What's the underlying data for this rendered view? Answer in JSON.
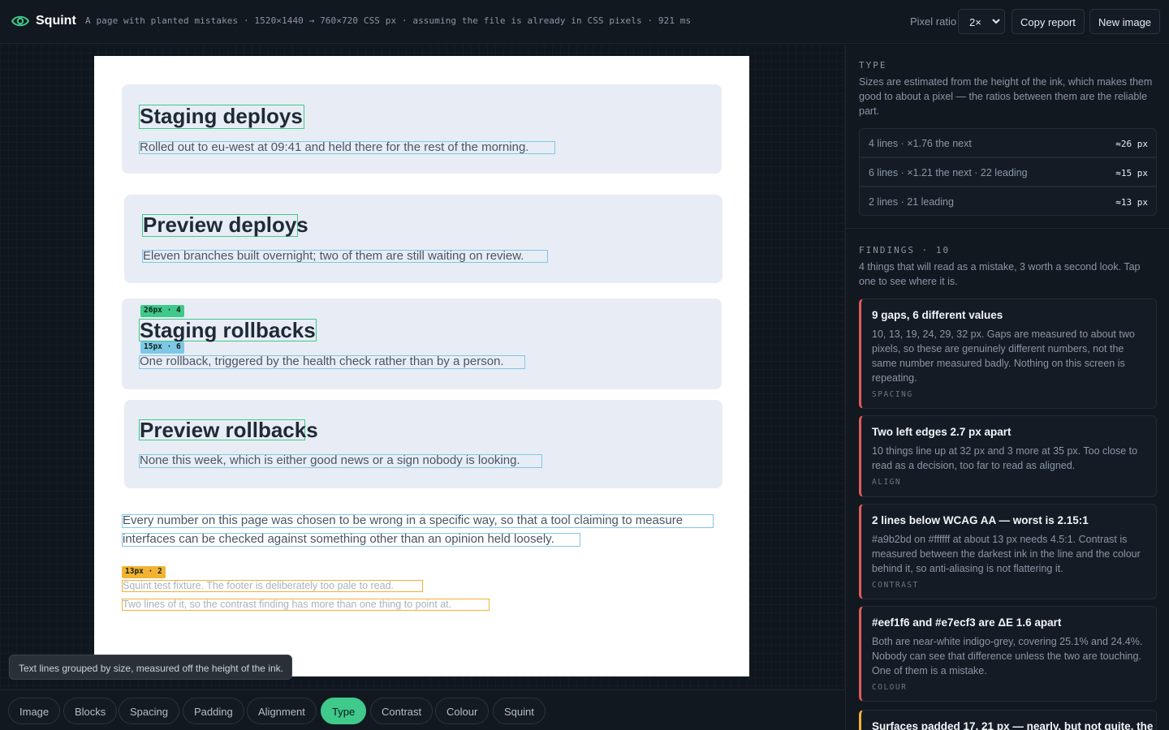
{
  "header": {
    "brand": "Squint",
    "meta": "A page with planted mistakes · 1520×1440 → 760×720 CSS px · assuming the file is already in CSS pixels · 921 ms",
    "pixel_ratio_label": "Pixel ratio",
    "pixel_ratio_value": "2×",
    "copy_report": "Copy report",
    "new_image": "New image"
  },
  "doc": {
    "cards": [
      {
        "title": "Staging deploys",
        "body": "Rolled out to eu-west at 09:41 and held there for the rest of the morning."
      },
      {
        "title": "Preview deploys",
        "body": "Eleven branches built overnight; two of them are still waiting on review."
      },
      {
        "title": "Staging rollbacks",
        "body": "One rollback, triggered by the health check rather than by a person."
      },
      {
        "title": "Preview rollbacks",
        "body": "None this week, which is either good news or a sign nobody is looking."
      }
    ],
    "paragraph": [
      "Every number on this page was chosen to be wrong in a specific way, so that a tool claiming to measure",
      "interfaces can be checked against something other than an opinion held loosely."
    ],
    "footer": [
      "Squint test fixture. The footer is deliberately too pale to read.",
      "Two lines of it, so the contrast finding has more than one thing to point at."
    ],
    "tags": {
      "h": "26px · 4",
      "b": "15px · 6",
      "f": "13px · 2"
    }
  },
  "tooltip": "Text lines grouped by size, measured off the height of the ink.",
  "tabs": [
    "Image",
    "Blocks",
    "Spacing",
    "Padding",
    "Alignment",
    "Type",
    "Contrast",
    "Colour",
    "Squint"
  ],
  "active_tab": "Type",
  "panel": {
    "type_title": "TYPE",
    "type_desc": "Sizes are estimated from the height of the ink, which makes them good to about a pixel — the ratios between them are the reliable part.",
    "type_rows": [
      {
        "label": "4 lines · ×1.76 the next",
        "value": "≈26 px"
      },
      {
        "label": "6 lines · ×1.21 the next · 22 leading",
        "value": "≈15 px"
      },
      {
        "label": "2 lines · 21 leading",
        "value": "≈13 px"
      }
    ],
    "findings_title": "FINDINGS · 10",
    "findings_desc": "4 things that will read as a mistake, 3 worth a second look. Tap one to see where it is.",
    "findings": [
      {
        "title": "9 gaps, 6 different values",
        "body": "10, 13, 19, 24, 29, 32 px. Gaps are measured to about two pixels, so these are genuinely different numbers, not the same number measured badly. Nothing on this screen is repeating.",
        "category": "SPACING"
      },
      {
        "title": "Two left edges 2.7 px apart",
        "body": "10 things line up at 32 px and 3 more at 35 px. Too close to read as a decision, too far to read as aligned.",
        "category": "ALIGN"
      },
      {
        "title": "2 lines below WCAG AA — worst is 2.15:1",
        "body": "#a9b2bd on #ffffff at about 13 px needs 4.5:1. Contrast is measured between the darkest ink in the line and the colour behind it, so anti-aliasing is not flattering it.",
        "category": "CONTRAST"
      },
      {
        "title": "#eef1f6 and #e7ecf3 are ΔE 1.6 apart",
        "body": "Both are near-white indigo-grey, covering 25.1% and 24.4%. Nobody can see that difference unless the two are touching. One of them is a mistake.",
        "category": "COLOUR"
      },
      {
        "title": "Surfaces padded 17, 21 px — nearly, but not quite, the",
        "body": "",
        "category": ""
      }
    ]
  },
  "colors": {
    "accent": "#3fc98a",
    "error": "#e25b5b",
    "warning": "#f2b233",
    "info": "#7fc7e6"
  }
}
